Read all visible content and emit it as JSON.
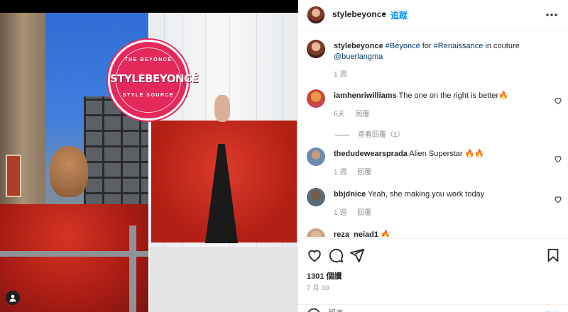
{
  "post": {
    "username": "stylebeyonce",
    "follow_label": "追蹤",
    "separator": "•",
    "caption_user": "stylebeyonce",
    "caption_parts": [
      "#Beyoncé",
      " for ",
      "#Renaissance",
      " in couture "
    ],
    "caption_mention": "@buerlangma",
    "caption_time": "1 週"
  },
  "logo": {
    "top_text": "THE BEYONCÉ",
    "word": "STYLEBEYONCÉ",
    "bottom_text": "STYLE SOURCE"
  },
  "comments": [
    {
      "user": "iamhenriwilliams",
      "text": "The one on the right is better🔥",
      "time": "6天",
      "reply": "回覆"
    },
    {
      "user": "thedudewearsprada",
      "text": "Alien Superstar 🔥🔥",
      "time": "1 週",
      "reply": "回覆"
    },
    {
      "user": "bbjdnice",
      "text": "Yeah, she making you work today",
      "time": "1 週",
      "reply": "回覆"
    },
    {
      "user": "reza_neiad1",
      "text": "🔥"
    }
  ],
  "view_replies": "查看回覆（1）",
  "likes": "1301 個讚",
  "date": "7 月 30",
  "add_comment": {
    "placeholder": "留言……",
    "post_label": "發佈"
  },
  "icons": {
    "more": "more-icon",
    "heart": "heart-icon",
    "comment": "comment-icon",
    "share": "share-icon",
    "bookmark": "bookmark-icon",
    "emoji": "emoji-icon",
    "user": "user-tag-icon"
  },
  "colors": {
    "link": "#00376b",
    "follow": "#0095f6",
    "logo": "#e4285a",
    "muted": "#8e8e8e"
  }
}
